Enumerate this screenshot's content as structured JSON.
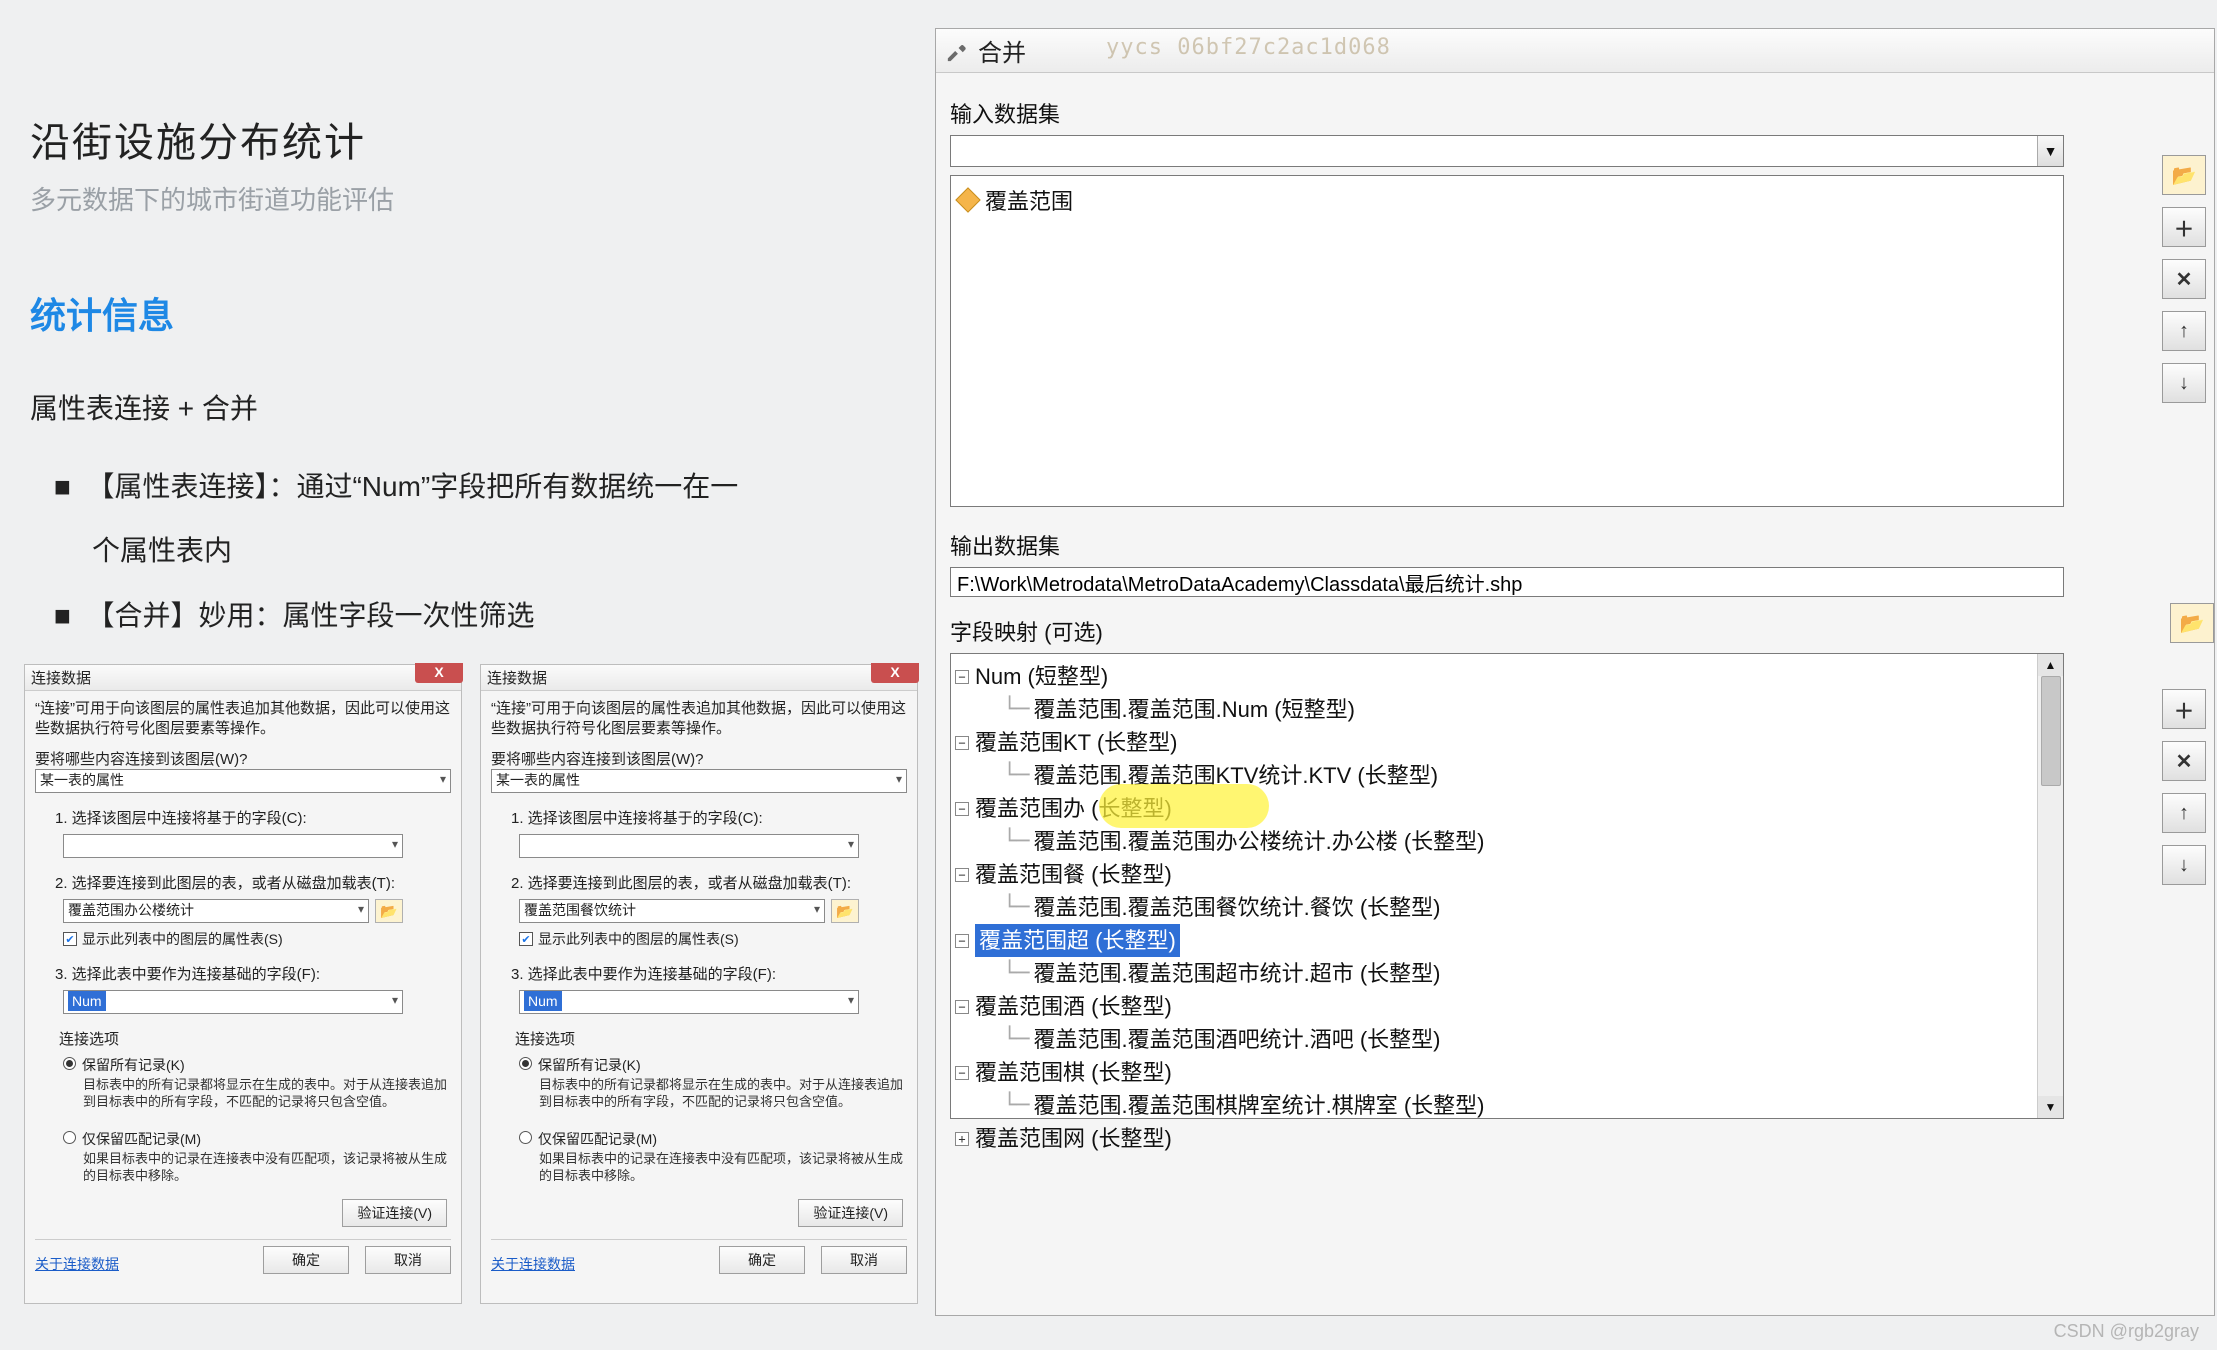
{
  "left": {
    "title": "沿街设施分布统计",
    "subtitle": "多元数据下的城市街道功能评估",
    "section": "统计信息",
    "line1": "属性表连接  + 合并",
    "bullet1a": "【属性表连接】：通过“Num”字段把所有数据统一在一",
    "bullet1b": "个属性表内",
    "bullet2": "【合并】妙用：属性字段一次性筛选"
  },
  "join": {
    "title": "连接数据",
    "desc": "“连接”可用于向该图层的属性表追加其他数据，因此可以使用这些数据执行符号化图层要素等操作。",
    "q0": "要将哪些内容连接到该图层(W)?",
    "tableAttr": "某一表的属性",
    "step1": "1. 选择该图层中连接将基于的字段(C):",
    "step2": "2. 选择要连接到此图层的表，或者从磁盘加载表(T):",
    "tableOptA": "覆盖范围办公楼统计",
    "tableOptB": "覆盖范围餐饮统计",
    "showCheck": "显示此列表中的图层的属性表(S)",
    "step3": "3. 选择此表中要作为连接基础的字段(F):",
    "numField": "Num",
    "joinOpts": "连接选项",
    "radioKeep": "保留所有记录(K)",
    "radioKeepDesc": "目标表中的所有记录都将显示在生成的表中。对于从连接表追加到目标表中的所有字段，不匹配的记录将只包含空值。",
    "radioMatch": "仅保留匹配记录(M)",
    "radioMatchDesc": "如果目标表中的记录在连接表中没有匹配项，该记录将被从生成的目标表中移除。",
    "validate": "验证连接(V)",
    "about": "关于连接数据",
    "ok": "确定",
    "cancel": "取消"
  },
  "merge": {
    "title": "合并",
    "watermark": "yycs          06bf27c2ac1d068",
    "inputLabel": "输入数据集",
    "layer": "覆盖范围",
    "outputLabel": "输出数据集",
    "outputPath": "F:\\Work\\Metrodata\\MetroDataAcademy\\Classdata\\最后统计.shp",
    "mapLabel": "字段映射 (可选)",
    "tree": [
      {
        "p": "Num (短整型)",
        "c": "覆盖范围.覆盖范围.Num (短整型)",
        "exp": "−"
      },
      {
        "p": "覆盖范围KT (长整型)",
        "c": "覆盖范围.覆盖范围KTV统计.KTV (长整型)",
        "exp": "−"
      },
      {
        "p": "覆盖范围办 (长整型)",
        "c": "覆盖范围.覆盖范围办公楼统计.办公楼 (长整型)",
        "exp": "−"
      },
      {
        "p": "覆盖范围餐 (长整型)",
        "c": "覆盖范围.覆盖范围餐饮统计.餐饮 (长整型)",
        "exp": "−",
        "pyellow": true
      },
      {
        "p": "覆盖范围超 (长整型)",
        "c": "覆盖范围.覆盖范围超市统计.超市 (长整型)",
        "exp": "−",
        "selected": true,
        "cyellow": true
      },
      {
        "p": "覆盖范围酒 (长整型)",
        "c": "覆盖范围.覆盖范围酒吧统计.酒吧 (长整型)",
        "exp": "−"
      },
      {
        "p": "覆盖范围棋 (长整型)",
        "c": "覆盖范围.覆盖范围棋牌室统计.棋牌室 (长整型)",
        "exp": "−"
      },
      {
        "p": "覆盖范围网 (长整型)",
        "c": "",
        "exp": "+"
      }
    ]
  },
  "credit": "CSDN @rgb2gray"
}
